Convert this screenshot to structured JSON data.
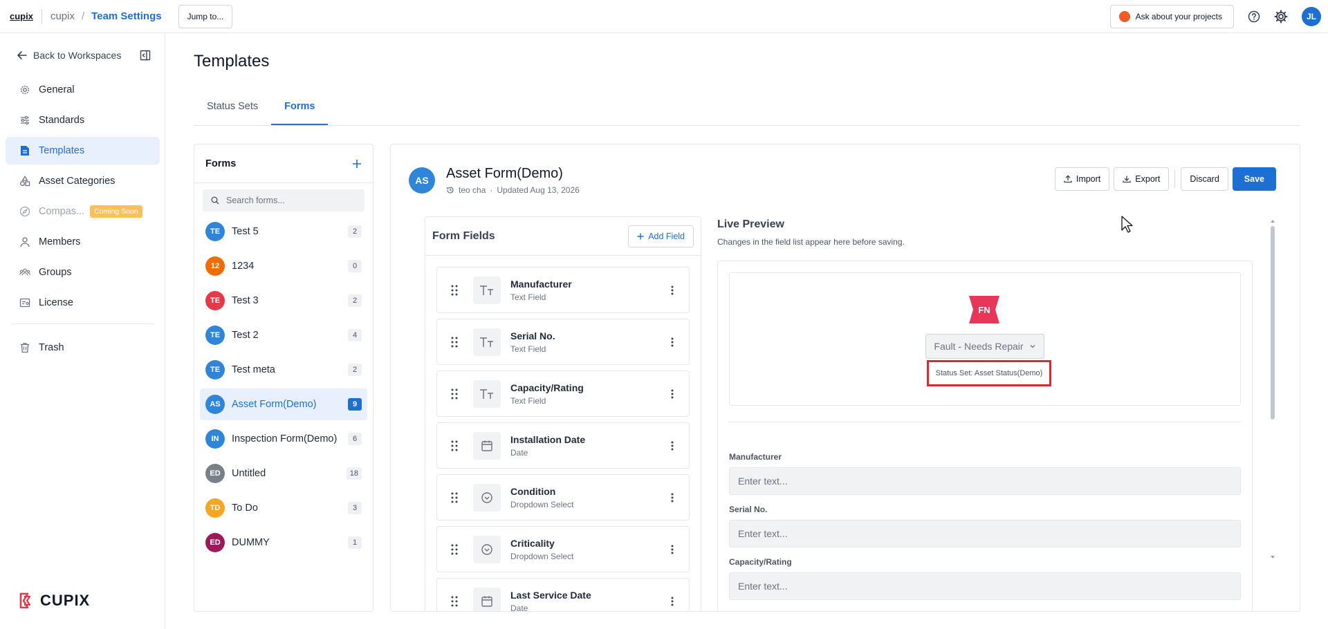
{
  "topbar": {
    "logo": "cupix",
    "org": "cupix",
    "separator": "/",
    "team": "Team Settings",
    "jump": "Jump to...",
    "ask": "Ask about your projects",
    "avatar": "JL"
  },
  "sidebar": {
    "back": "Back to Workspaces",
    "items": [
      {
        "label": "General",
        "icon": "gear-icon"
      },
      {
        "label": "Standards",
        "icon": "sliders-icon"
      },
      {
        "label": "Templates",
        "icon": "document-icon"
      },
      {
        "label": "Asset Categories",
        "icon": "shapes-icon"
      },
      {
        "label": "Compas...",
        "icon": "compass-icon",
        "badge": "Coming Soon"
      },
      {
        "label": "Members",
        "icon": "user-icon"
      },
      {
        "label": "Groups",
        "icon": "group-icon"
      },
      {
        "label": "License",
        "icon": "license-icon"
      },
      {
        "label": "Trash",
        "icon": "trash-icon"
      }
    ],
    "brand": "CUPIX"
  },
  "page": {
    "title": "Templates",
    "tabs": [
      "Status Sets",
      "Forms"
    ]
  },
  "forms_panel": {
    "title": "Forms",
    "search_placeholder": "Search forms...",
    "items": [
      {
        "initials": "TE",
        "name": "Test 5",
        "count": "2",
        "color": "#2f86d8"
      },
      {
        "initials": "12",
        "name": "1234",
        "count": "0",
        "color": "#ef6c00"
      },
      {
        "initials": "TE",
        "name": "Test 3",
        "count": "2",
        "color": "#e53948"
      },
      {
        "initials": "TE",
        "name": "Test 2",
        "count": "4",
        "color": "#2f86d8"
      },
      {
        "initials": "TE",
        "name": "Test meta",
        "count": "2",
        "color": "#2f86d8"
      },
      {
        "initials": "AS",
        "name": "Asset Form(Demo)",
        "count": "9",
        "color": "#2f86d8"
      },
      {
        "initials": "IN",
        "name": "Inspection Form(Demo)",
        "count": "6",
        "color": "#2f86d8"
      },
      {
        "initials": "ED",
        "name": "Untitled",
        "count": "18",
        "color": "#78808a"
      },
      {
        "initials": "TD",
        "name": "To Do",
        "count": "3",
        "color": "#f5a623"
      },
      {
        "initials": "ED",
        "name": "DUMMY",
        "count": "1",
        "color": "#9b1b5a"
      }
    ]
  },
  "editor": {
    "avatar": "AS",
    "title": "Asset Form(Demo)",
    "author": "teo cha",
    "dot": "·",
    "updated": "Updated Aug 13, 2026",
    "actions": {
      "import": "Import",
      "export": "Export",
      "discard": "Discard",
      "save": "Save"
    },
    "fields_title": "Form Fields",
    "add_field": "Add Field",
    "fields": [
      {
        "name": "Manufacturer",
        "type": "Text Field",
        "icon": "text-icon"
      },
      {
        "name": "Serial No.",
        "type": "Text Field",
        "icon": "text-icon"
      },
      {
        "name": "Capacity/Rating",
        "type": "Text Field",
        "icon": "text-icon"
      },
      {
        "name": "Installation Date",
        "type": "Date",
        "icon": "calendar-icon"
      },
      {
        "name": "Condition",
        "type": "Dropdown Select",
        "icon": "dropdown-icon"
      },
      {
        "name": "Criticality",
        "type": "Dropdown Select",
        "icon": "dropdown-icon"
      },
      {
        "name": "Last Service Date",
        "type": "Date",
        "icon": "calendar-icon"
      }
    ],
    "preview": {
      "title": "Live Preview",
      "subtitle": "Changes in the field list appear here before saving.",
      "badge": "FN",
      "badge_color": "#e8365a",
      "status_value": "Fault - Needs Repair",
      "status_set": "Status Set: Asset Status(Demo)",
      "inputs": [
        {
          "label": "Manufacturer",
          "placeholder": "Enter text..."
        },
        {
          "label": "Serial No.",
          "placeholder": "Enter text..."
        },
        {
          "label": "Capacity/Rating",
          "placeholder": "Enter text..."
        }
      ]
    }
  },
  "colors": {
    "accent": "#1d6fd1",
    "highlight": "#e0262e"
  }
}
